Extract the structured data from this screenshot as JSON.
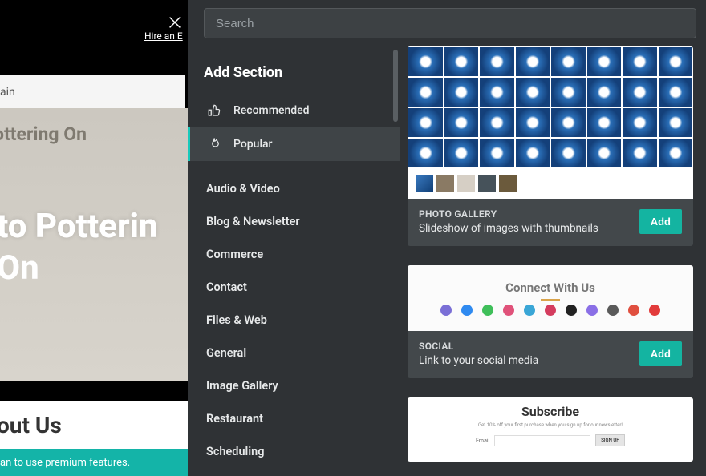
{
  "background": {
    "hire_link": "Hire an E",
    "domain_partial": "ain",
    "hero_small": "ottering On",
    "hero_welcome_line1": "to Potterin",
    "hero_welcome_line2": "On",
    "about_partial": "out Us",
    "banner_partial": "an to use premium features."
  },
  "search": {
    "placeholder": "Search",
    "value": ""
  },
  "sidebar": {
    "heading": "Add Section",
    "top_items": [
      {
        "label": "Recommended",
        "icon": "thumbsup-icon",
        "active": false
      },
      {
        "label": "Popular",
        "icon": "flame-icon",
        "active": true
      }
    ],
    "categories": [
      "Audio & Video",
      "Blog & Newsletter",
      "Commerce",
      "Contact",
      "Files & Web",
      "General",
      "Image Gallery",
      "Restaurant",
      "Scheduling"
    ]
  },
  "cards": {
    "photo_gallery": {
      "title": "PHOTO GALLERY",
      "desc": "Slideshow of images with thumbnails",
      "add_label": "Add"
    },
    "social": {
      "title": "SOCIAL",
      "desc": "Link to your social media",
      "add_label": "Add",
      "preview_heading": "Connect With Us",
      "icon_colors": [
        "#7a6fd6",
        "#2f8af0",
        "#3fbf5a",
        "#e0527a",
        "#3aa6d6",
        "#d43c5e",
        "#222",
        "#8a6fe6",
        "#5a5a5a",
        "#e04f3f",
        "#e23b3b"
      ]
    },
    "subscribe": {
      "preview_heading": "Subscribe",
      "preview_sub": "Get 10% off your first purchase when you sign up for our newsletter!",
      "preview_label": "Email",
      "preview_button": "SIGN UP"
    }
  }
}
